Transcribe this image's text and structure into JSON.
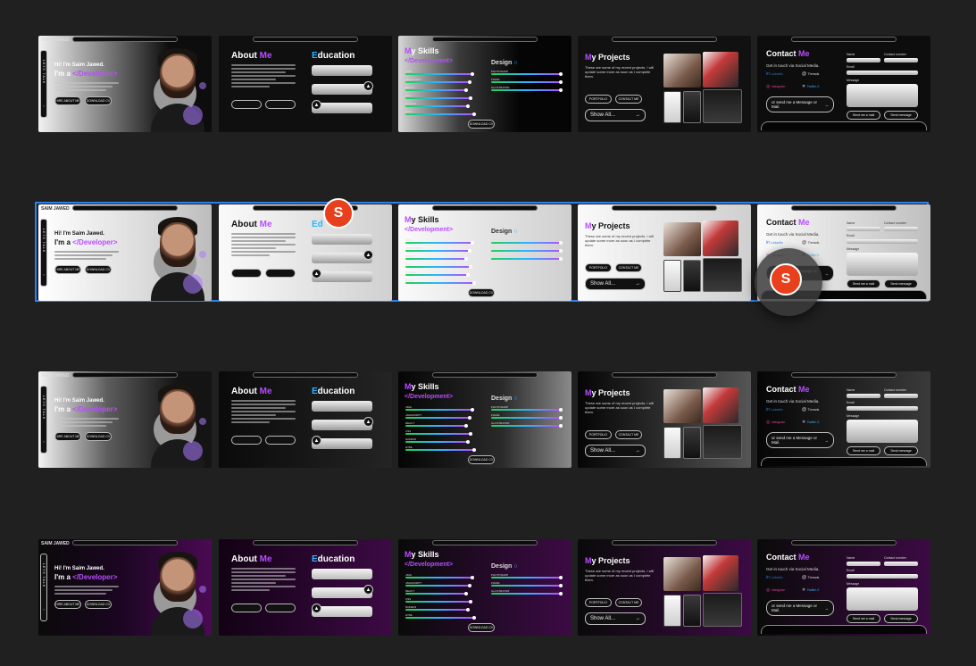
{
  "canvas": {
    "background": "#202020",
    "selection_color": "#2f80ed",
    "avatar_color": "#e8401c"
  },
  "cursor_avatar": {
    "initial": "S"
  },
  "rows": [
    {
      "theme": "dark"
    },
    {
      "theme": "light"
    },
    {
      "theme": "mid"
    },
    {
      "theme": "purple"
    }
  ],
  "hero": {
    "brand": "SAIM JAWED",
    "greeting": "Hi! I'm Saim Jawed.",
    "role_prefix": "I'm a",
    "role": "</Developer>",
    "side_text": "LETS TALK",
    "btn_hire": "HIRE ABOUT ME",
    "btn_download": "DOWNLOAD CV"
  },
  "about": {
    "title_a": "About ",
    "title_b": "Me",
    "edu_title_a": "E",
    "edu_title_b": "ducation",
    "edu_short": "Ed"
  },
  "skills": {
    "title_a": "M",
    "title_b": "y Skills",
    "dev_label": "</Development>",
    "design_label": "Design",
    "dev_items": [
      "JAVA",
      "JAVASCRIPT",
      "REACT",
      "CSS",
      "NODEJS",
      "HTML"
    ],
    "design_items": [
      "PHOTOSHOP",
      "FIGMA",
      "ILLUSTRATOR"
    ],
    "download_btn": "DOWNLOAD CV",
    "overflow": "SI"
  },
  "projects": {
    "title_a": "M",
    "title_b": "y  Projects",
    "desc": "These are some of my recent projects. I will update some more as soon as I complete them.",
    "btn_a": "PORTFOLIO",
    "btn_b": "CONTACT ME",
    "show_all": "Show All..."
  },
  "contact": {
    "title_a": "Contact ",
    "title_b": "Me",
    "subtitle": "Get in touch via Social Media.",
    "social": [
      "LinkedIn",
      "Threads",
      "Instagram",
      "Twitter-X"
    ],
    "name": "Name",
    "number": "Contact number",
    "email": "Email",
    "message": "Message",
    "send_alt": "or send me a Message or Mail.",
    "btn_mail": "Send me a mail",
    "btn_msg": "Send message"
  }
}
